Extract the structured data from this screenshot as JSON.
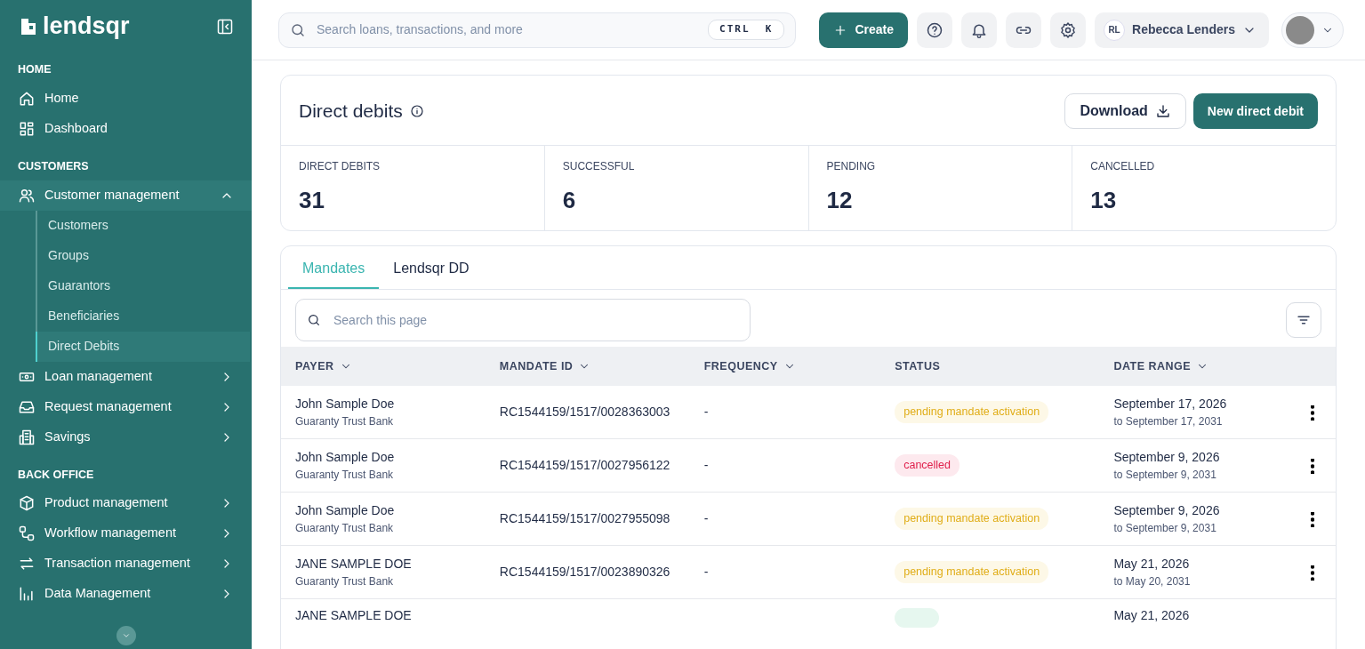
{
  "sidebar": {
    "brand": "lendsqr",
    "sections": [
      {
        "heading": "HOME",
        "items": [
          {
            "label": "Home",
            "selected": false
          },
          {
            "label": "Dashboard",
            "selected": false
          }
        ]
      },
      {
        "heading": "CUSTOMERS",
        "items": [
          {
            "label": "Customer management",
            "selected": false,
            "expanded": true,
            "children": [
              {
                "label": "Customers",
                "selected": false
              },
              {
                "label": "Groups",
                "selected": false
              },
              {
                "label": "Guarantors",
                "selected": false
              },
              {
                "label": "Beneficiaries",
                "selected": false
              },
              {
                "label": "Direct Debits",
                "selected": true
              }
            ]
          },
          {
            "label": "Loan management",
            "selected": false,
            "expanded": false
          },
          {
            "label": "Request management",
            "selected": false,
            "expanded": false
          },
          {
            "label": "Savings",
            "selected": false,
            "expanded": false
          }
        ]
      },
      {
        "heading": "BACK OFFICE",
        "items": [
          {
            "label": "Product management",
            "selected": false,
            "expanded": false
          },
          {
            "label": "Workflow management",
            "selected": false,
            "expanded": false
          },
          {
            "label": "Transaction management",
            "selected": false,
            "expanded": false
          },
          {
            "label": "Data Management",
            "selected": false,
            "expanded": false
          }
        ]
      }
    ]
  },
  "topbar": {
    "search": {
      "placeholder": "Search loans, transactions, and more",
      "shortcut": "CTRL  K"
    },
    "create": "Create",
    "user": {
      "initials": "RL",
      "name": "Rebecca Lenders"
    }
  },
  "page": {
    "title": "Direct debits",
    "actions": [
      "Download",
      "New direct debit"
    ],
    "stats": [
      {
        "label": "DIRECT DEBITS",
        "value": "31"
      },
      {
        "label": "SUCCESSFUL",
        "value": "6"
      },
      {
        "label": "PENDING",
        "value": "12"
      },
      {
        "label": "CANCELLED",
        "value": "13"
      }
    ]
  },
  "tabs": [
    {
      "label": "Mandates",
      "selected": true
    },
    {
      "label": "Lendsqr DD",
      "selected": false
    }
  ],
  "table": {
    "search": {
      "placeholder": "Search this page"
    },
    "columns": [
      {
        "label": "PAYER",
        "sortable": true
      },
      {
        "label": "MANDATE ID",
        "sortable": true
      },
      {
        "label": "FREQUENCY",
        "sortable": true
      },
      {
        "label": "STATUS",
        "sortable": false
      },
      {
        "label": "DATE RANGE",
        "sortable": true
      }
    ],
    "rows": [
      {
        "payer": "John Sample Doe",
        "bank": "Guaranty Trust Bank",
        "mandate_id": "RC1544159/1517/0028363003",
        "frequency": "-",
        "status": {
          "label": "pending mandate activation",
          "kind": "pending"
        },
        "date": "September 17, 2026",
        "date_to": "to September 17, 2031"
      },
      {
        "payer": "John Sample Doe",
        "bank": "Guaranty Trust Bank",
        "mandate_id": "RC1544159/1517/0027956122",
        "frequency": "-",
        "status": {
          "label": "cancelled",
          "kind": "cancelled"
        },
        "date": "September 9, 2026",
        "date_to": "to September 9, 2031"
      },
      {
        "payer": "John Sample Doe",
        "bank": "Guaranty Trust Bank",
        "mandate_id": "RC1544159/1517/0027955098",
        "frequency": "-",
        "status": {
          "label": "pending mandate activation",
          "kind": "pending"
        },
        "date": "September 9, 2026",
        "date_to": "to September 9, 2031"
      },
      {
        "payer": "JANE SAMPLE DOE",
        "bank": "Guaranty Trust Bank",
        "mandate_id": "RC1544159/1517/0023890326",
        "frequency": "-",
        "status": {
          "label": "pending mandate activation",
          "kind": "pending"
        },
        "date": "May 21, 2026",
        "date_to": "to May 20, 2031"
      },
      {
        "payer": "JANE SAMPLE DOE",
        "status": {
          "kind": "active"
        },
        "date": "May 21, 2026"
      }
    ]
  }
}
